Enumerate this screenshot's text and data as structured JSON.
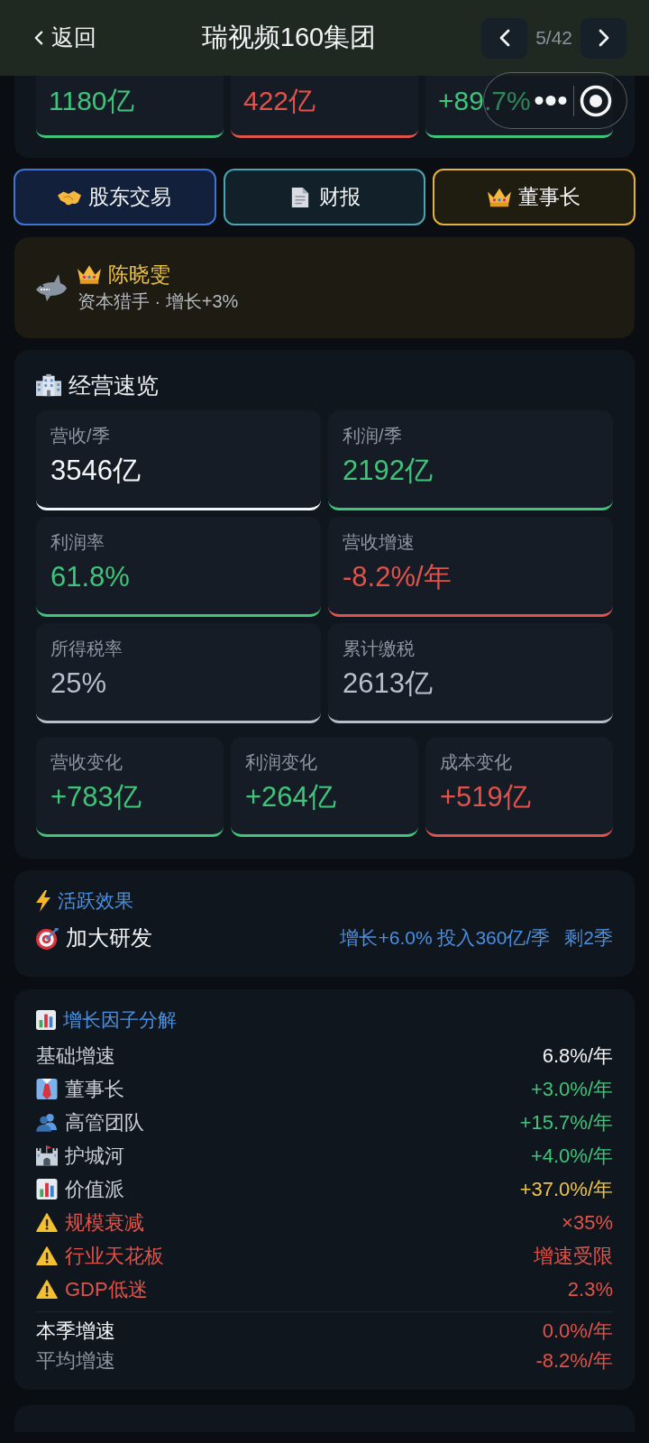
{
  "header": {
    "back_label": "返回",
    "title": "瑞视频160集团",
    "page_counter": "5/42"
  },
  "summary_tiles": [
    {
      "value": "1180亿",
      "color": "#3fc47a"
    },
    {
      "value": "422亿",
      "color": "#e0534a"
    },
    {
      "value": "+89.7%",
      "color": "#3fc47a"
    }
  ],
  "action_buttons": [
    {
      "kind": "trade",
      "label": "股东交易"
    },
    {
      "kind": "report",
      "label": "财报"
    },
    {
      "kind": "chairman",
      "label": "董事长"
    }
  ],
  "chairman": {
    "name": "陈晓雯",
    "subtitle": "资本猎手 · 增长+3%"
  },
  "overview": {
    "title": "经营速览",
    "tiles": [
      {
        "label": "营收/季",
        "value": "3546亿",
        "color": "#f4f5f7"
      },
      {
        "label": "利润/季",
        "value": "2192亿",
        "color": "#3fc47a"
      },
      {
        "label": "利润率",
        "value": "61.8%",
        "color": "#3fc47a"
      },
      {
        "label": "营收增速",
        "value": "-8.2%/年",
        "color": "#e0534a"
      },
      {
        "label": "所得税率",
        "value": "25%",
        "color": "#b9bdcc"
      },
      {
        "label": "累计缴税",
        "value": "2613亿",
        "color": "#b9bdcc"
      }
    ],
    "change_tiles": [
      {
        "label": "营收变化",
        "value": "+783亿",
        "color": "#3fc47a"
      },
      {
        "label": "利润变化",
        "value": "+264亿",
        "color": "#3fc47a"
      },
      {
        "label": "成本变化",
        "value": "+519亿",
        "color": "#e0534a"
      }
    ]
  },
  "active_effects": {
    "title": "活跃效果",
    "items": [
      {
        "name": "加大研发",
        "detail": "增长+6.0% 投入360亿/季",
        "remaining": "剩2季"
      }
    ]
  },
  "growth_factors": {
    "title": "增长因子分解",
    "factors": [
      {
        "kind": "base",
        "label": "基础增速",
        "value": "6.8%/年",
        "color": "#f4f5f7"
      },
      {
        "kind": "chairman",
        "label": "董事长",
        "value": "+3.0%/年",
        "color": "#3fc47a"
      },
      {
        "kind": "team",
        "label": "高管团队",
        "value": "+15.7%/年",
        "color": "#3fc47a"
      },
      {
        "kind": "moat",
        "label": "护城河",
        "value": "+4.0%/年",
        "color": "#3fc47a"
      },
      {
        "kind": "value",
        "label": "价值派",
        "value": "+37.0%/年",
        "color": "#eec447"
      },
      {
        "kind": "warning",
        "label": "规模衰减",
        "value": "×35%",
        "color": "#e0534a"
      },
      {
        "kind": "warning",
        "label": "行业天花板",
        "value": "增速受限",
        "color": "#e0534a"
      },
      {
        "kind": "warning",
        "label": "GDP低迷",
        "value": "2.3%",
        "color": "#e0534a"
      }
    ],
    "totals": [
      {
        "label": "本季增速",
        "value": "0.0%/年",
        "emphasized": true
      },
      {
        "label": "平均增速",
        "value": "-8.2%/年",
        "emphasized": false
      }
    ]
  }
}
